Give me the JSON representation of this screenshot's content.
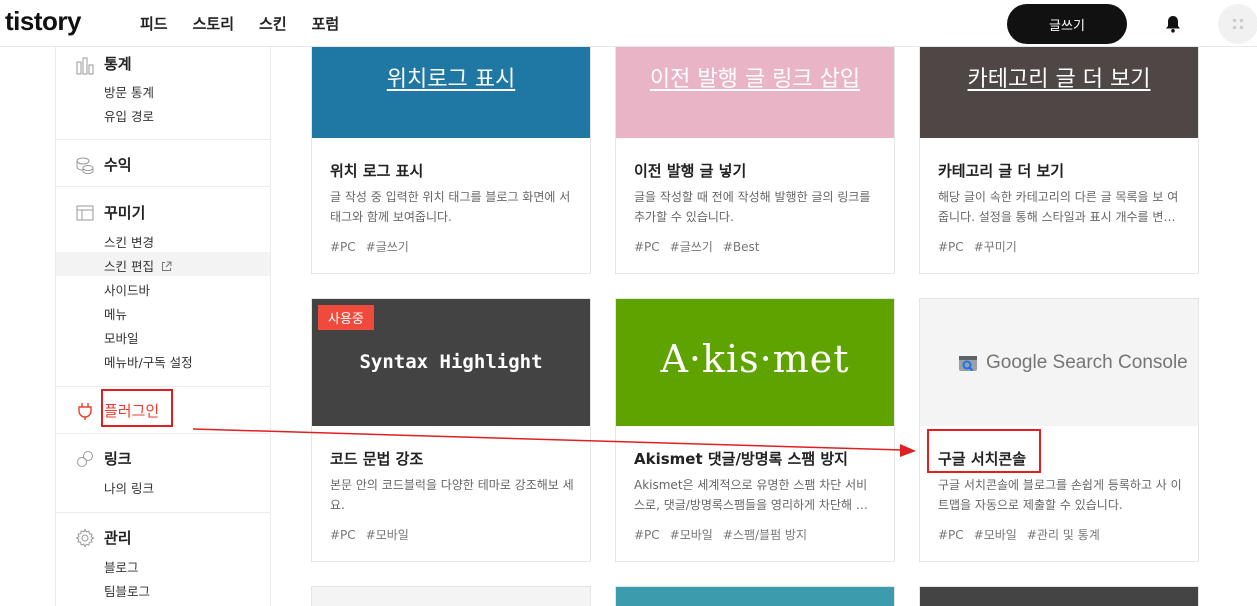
{
  "header": {
    "logo": "tistory",
    "nav": [
      "피드",
      "스토리",
      "스킨",
      "포럼"
    ],
    "write_label": "글쓰기"
  },
  "sidebar": {
    "stats": {
      "title": "통계",
      "items": [
        "방문 통계",
        "유입 경로"
      ]
    },
    "revenue": {
      "title": "수익"
    },
    "decorate": {
      "title": "꾸미기",
      "items": [
        "스킨 변경",
        "스킨 편집",
        "사이드바",
        "메뉴",
        "모바일",
        "메뉴바/구독 설정"
      ]
    },
    "plugin": {
      "title": "플러그인"
    },
    "link": {
      "title": "링크",
      "items": [
        "나의 링크"
      ]
    },
    "manage": {
      "title": "관리",
      "items": [
        "블로그",
        "팀블로그"
      ]
    }
  },
  "cards": [
    {
      "thumb_text": "위치로그 표시",
      "thumb_color": "#1f77a3",
      "title": "위치 로그 표시",
      "desc": "글 작성 중 입력한 위치 태그를 블로그 화면에 서 태그와 함께 보여줍니다.",
      "tags": [
        "#PC",
        "#글쓰기"
      ]
    },
    {
      "thumb_text": "이전 발행 글 링크 삽입",
      "thumb_color": "#eab4c7",
      "title": "이전 발행 글 넣기",
      "desc": "글을 작성할 때 전에 작성해 발행한 글의 링크를 추가할 수 있습니다.",
      "tags": [
        "#PC",
        "#글쓰기",
        "#Best"
      ]
    },
    {
      "thumb_text": "카테고리 글 더 보기",
      "thumb_color": "#4f4646",
      "title": "카테고리 글 더 보기",
      "desc": "해당 글이 속한 카테고리의 다른 글 목록을 보 여줍니다. 설정을 통해 스타일과 표시 개수를 변경할 수 있습니다.",
      "tags": [
        "#PC",
        "#꾸미기"
      ]
    },
    {
      "badge": "사용중",
      "thumb_text": "Syntax Highlight",
      "thumb_color": "#434343",
      "title": "코드 문법 강조",
      "desc": "본문 안의 코드블럭을 다양한 테마로 강조해보 세요.",
      "tags": [
        "#PC",
        "#모바일"
      ]
    },
    {
      "thumb_text": "A·kis·met",
      "thumb_color": "#5fa300",
      "title": "Akismet 댓글/방명록 스팸 방지",
      "desc": "Akismet은 세계적으로 유명한 스팸 차단 서비 스로, 댓글/방명록스팸들을 영리하게 차단해 드립니다.",
      "tags": [
        "#PC",
        "#모바일",
        "#스팸/블펌 방지"
      ]
    },
    {
      "thumb_text": "Google Search Console",
      "thumb_color": "#f4f4f4",
      "title": "구글 서치콘솔",
      "desc": "구글 서치콘솔에 블로그를 손쉽게 등록하고 사 이트맵을 자동으로 제출할 수 있습니다.",
      "tags": [
        "#PC",
        "#모바일",
        "#관리 및 통계"
      ]
    }
  ],
  "row3_colors": [
    "#f4f4f4",
    "#3b9cae",
    "#444444"
  ],
  "annotation_color": "#e02020"
}
